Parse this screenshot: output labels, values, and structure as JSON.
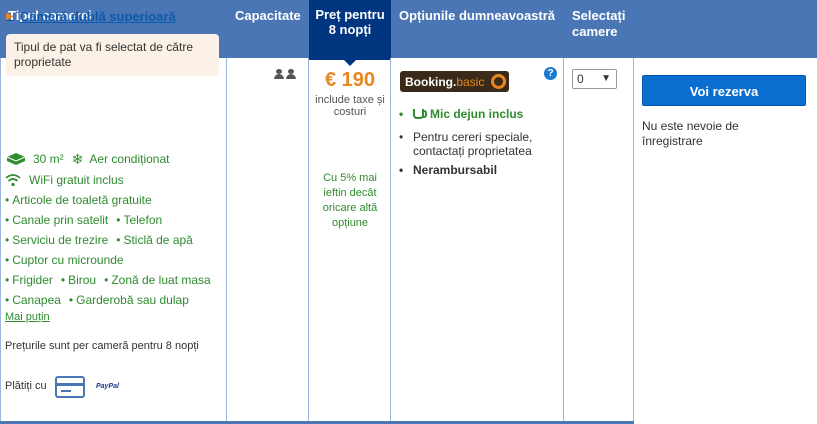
{
  "headers": {
    "room_type": "Tipul camerei",
    "capacity": "Capacitate",
    "price": "Preț pentru 8 nopți",
    "options": "Opțiunile dumneavoastră",
    "select": "Selectați camere"
  },
  "room": {
    "title": "Cameră dublă superioară",
    "bed_note": "Tipul de pat va fi selectat de către proprietate",
    "area": "30 m²",
    "ac": "Aer condiționat",
    "wifi": "WiFi gratuit inclus",
    "facilities": [
      [
        "Articole de toaletă gratuite"
      ],
      [
        "Canale prin satelit",
        "Telefon"
      ],
      [
        "Serviciu de trezire",
        "Sticlă de apă"
      ],
      [
        "Cuptor cu microunde"
      ],
      [
        "Frigider",
        "Birou",
        "Zonă de luat masa"
      ],
      [
        "Canapea",
        "Garderobă sau dulap"
      ]
    ],
    "less_link": "Mai puțin",
    "prices_note": "Prețurile sunt per cameră pentru 8 nopți",
    "pay_with": "Plătiți cu",
    "paypal": "PayPal"
  },
  "price": {
    "value": "€ 190",
    "includes": "include taxe și costuri",
    "cheaper": "Cu 5% mai ieftin decât oricare altă opțiune"
  },
  "options": {
    "badge_booking": "Booking.",
    "badge_basic": "basic",
    "help": "?",
    "breakfast": "Mic dejun inclus",
    "special_requests": "Pentru cereri speciale, contactați proprietatea",
    "non_refundable": "Nerambursabil"
  },
  "select": {
    "value": "0"
  },
  "reserve": {
    "button": "Voi rezerva",
    "no_registration": "Nu este nevoie de înregistrare"
  }
}
